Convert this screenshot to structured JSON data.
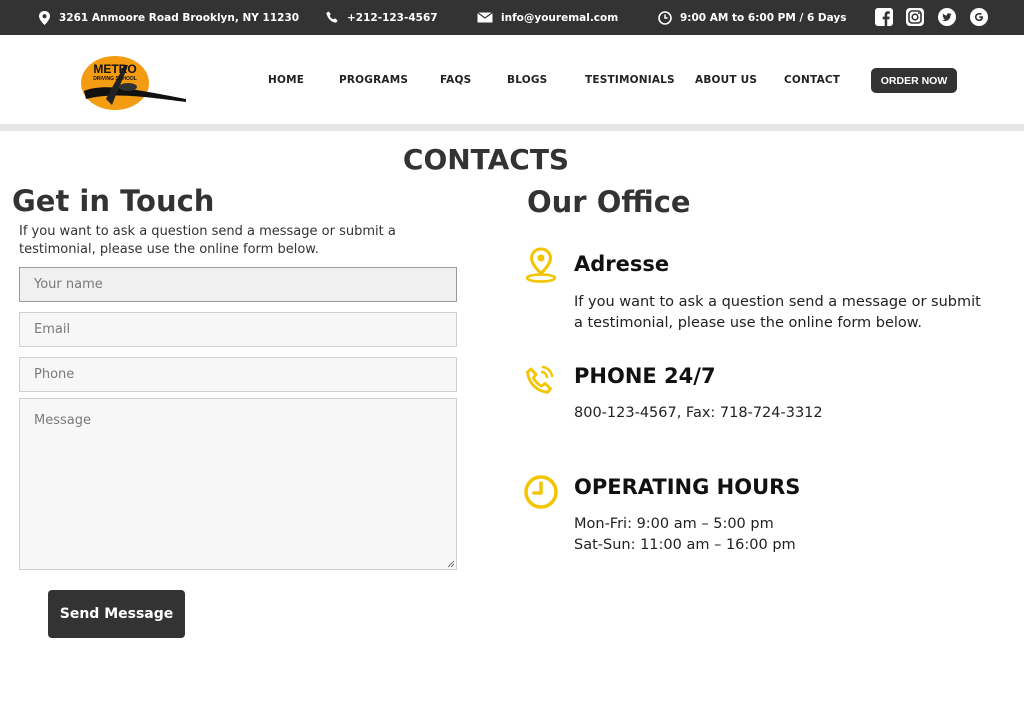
{
  "topbar": {
    "address": "3261 Anmoore Road Brooklyn, NY 11230",
    "phone": "+212-123-4567",
    "email": "info@youremal.com",
    "hours": "9:00 AM to 6:00 PM / 6 Days",
    "social_icons": [
      "facebook-icon",
      "instagram-icon",
      "twitter-icon",
      "google-icon"
    ]
  },
  "logo": {
    "line1": "METRO",
    "line2": "DRIVING SCHOOL"
  },
  "nav": {
    "items": [
      {
        "label": "HOME"
      },
      {
        "label": "PROGRAMS"
      },
      {
        "label": "FAQS"
      },
      {
        "label": "BLOGS"
      },
      {
        "label": "TESTIMONIALS"
      },
      {
        "label": "ABOUT US"
      },
      {
        "label": "CONTACT"
      }
    ],
    "order_button": "ORDER NOW"
  },
  "page": {
    "title": "CONTACTS"
  },
  "get_in_touch": {
    "heading": "Get in Touch",
    "intro": "If you want to ask a question send a message or submit a testimonial, please use the online form below.",
    "form": {
      "name_placeholder": "Your name",
      "email_placeholder": "Email",
      "phone_placeholder": "Phone",
      "message_placeholder": "Message",
      "submit_label": "Send Message"
    }
  },
  "office": {
    "heading": "Our Office",
    "address": {
      "title": "Adresse",
      "text": "If you want to ask a question send a message or submit a testimonial, please use the online form below."
    },
    "phone": {
      "title": "PHONE 24/7",
      "text": "800-123-4567, Fax: 718-724-3312"
    },
    "hours": {
      "title": "OPERATING HOURS",
      "line1": "Mon-Fri: 9:00 am – 5:00 pm",
      "line2": "Sat-Sun: 11:00 am – 16:00 pm"
    }
  },
  "colors": {
    "dark": "#333333",
    "accent": "#f5c400",
    "logo_orange": "#f39c12"
  }
}
